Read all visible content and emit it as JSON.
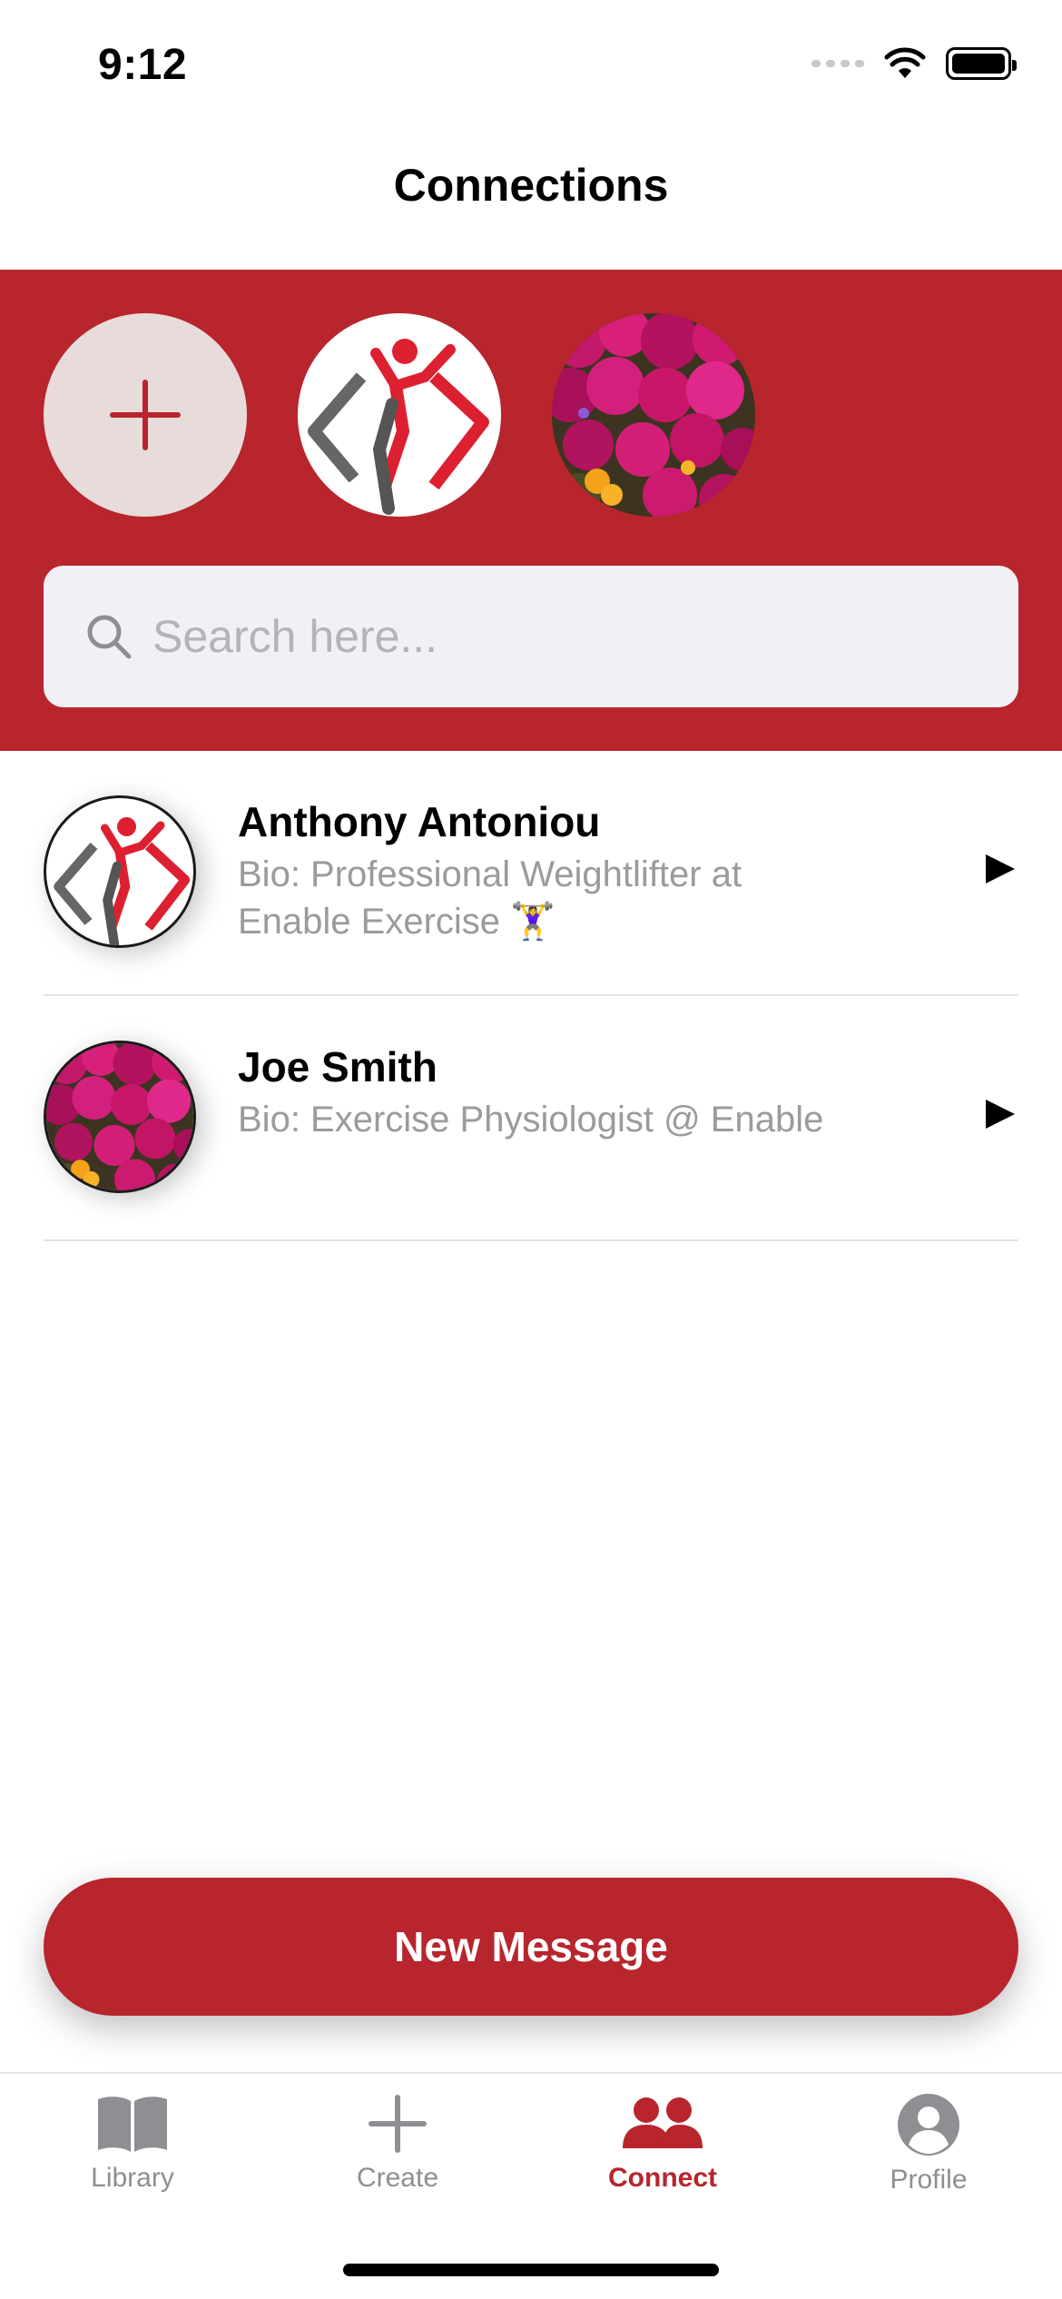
{
  "status_bar": {
    "time": "9:12"
  },
  "nav": {
    "title": "Connections"
  },
  "header": {
    "add_label": "+",
    "search": {
      "placeholder": "Search here..."
    }
  },
  "connections": [
    {
      "name": "Anthony Antoniou",
      "bio_line1": "Bio: Professional Weightlifter at",
      "bio_line2": "Enable Exercise 🏋️‍♀️"
    },
    {
      "name": "Joe Smith",
      "bio_line1": "Bio: Exercise Physiologist @ Enable",
      "bio_line2": ""
    }
  ],
  "actions": {
    "new_message": "New Message"
  },
  "tabs": [
    {
      "label": "Library",
      "icon": "book-icon"
    },
    {
      "label": "Create",
      "icon": "plus-icon"
    },
    {
      "label": "Connect",
      "icon": "people-icon"
    },
    {
      "label": "Profile",
      "icon": "person-circle-icon"
    }
  ],
  "colors": {
    "accent": "#b8252d",
    "add_bg": "#e8dcdb",
    "search_bg": "#f0f0f5",
    "muted": "#8e8e93"
  }
}
